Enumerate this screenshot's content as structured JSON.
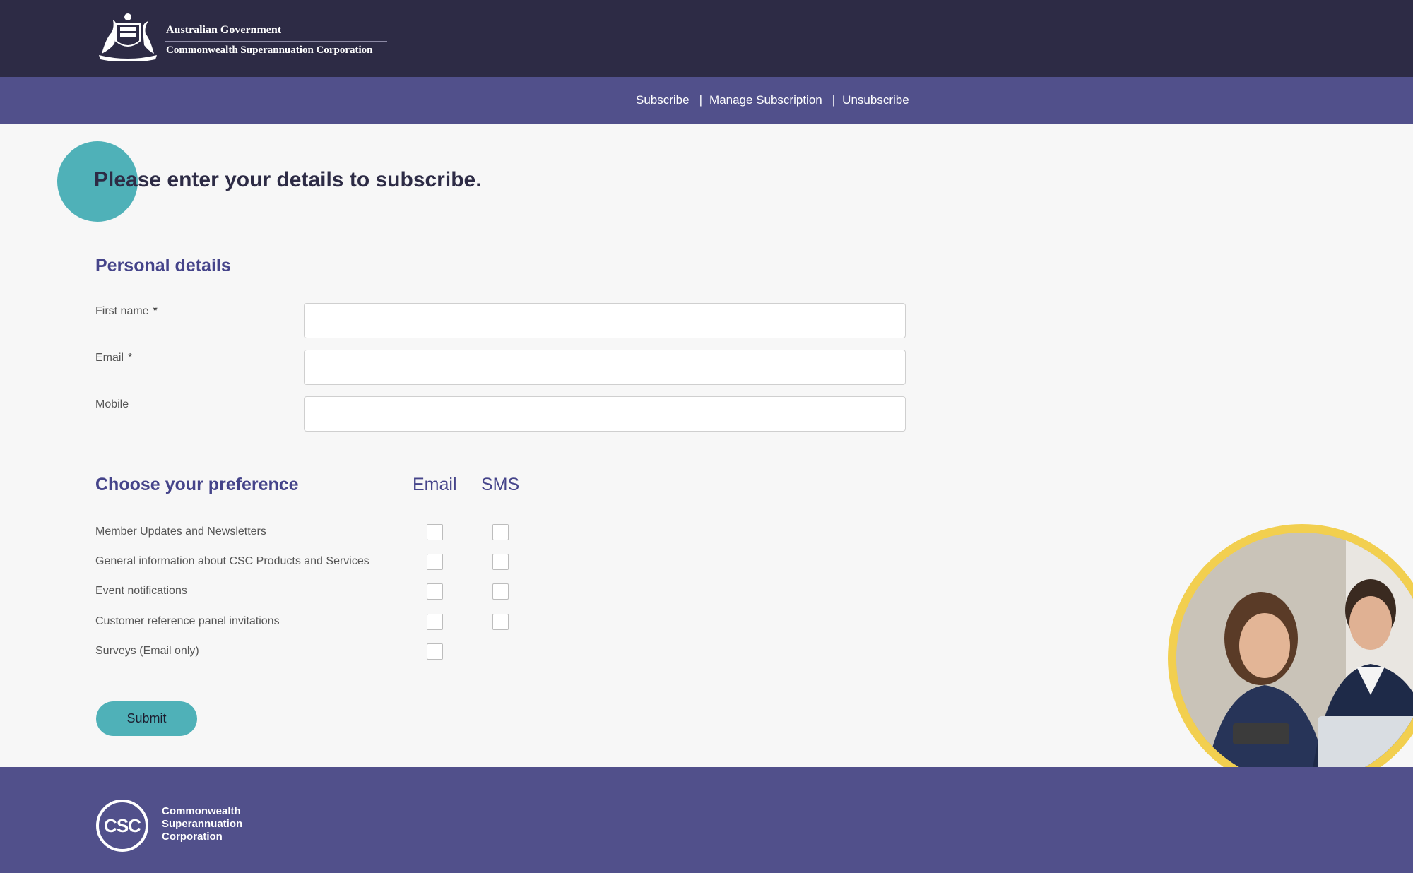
{
  "header": {
    "gov_line1": "Australian Government",
    "gov_line2": "Commonwealth Superannuation Corporation"
  },
  "nav": {
    "items": [
      "Subscribe",
      "Manage Subscription",
      "Unsubscribe"
    ],
    "separator": "|"
  },
  "page_title": "Please enter your details to subscribe.",
  "personal": {
    "heading": "Personal details",
    "required_marker": "*",
    "fields": [
      {
        "label": "First name",
        "value": ""
      },
      {
        "label": "Email",
        "value": ""
      },
      {
        "label": "Mobile",
        "value": ""
      }
    ]
  },
  "preference": {
    "heading": "Choose your preference",
    "col_email": "Email",
    "col_sms": "SMS",
    "rows": [
      {
        "label": "Member Updates and Newsletters",
        "email": false,
        "sms": false
      },
      {
        "label": "General information about CSC Products and Services",
        "email": false,
        "sms": false
      },
      {
        "label": "Event notifications",
        "email": false,
        "sms": false
      },
      {
        "label": "Customer reference panel invitations",
        "email": false,
        "sms": false
      },
      {
        "label": "Surveys (Email only)",
        "email": false
      }
    ]
  },
  "submit_label": "Submit",
  "footer": {
    "logo_mark": "CSC",
    "org_line1": "Commonwealth",
    "org_line2": "Superannuation",
    "org_line3": "Corporation"
  },
  "colors": {
    "header_bg": "#2d2b45",
    "nav_bg": "#51508b",
    "accent_teal": "#4fb1b8",
    "heading_purple": "#45448a",
    "photo_ring": "#f2cf4f"
  },
  "icons": [
    "coat-of-arms-icon",
    "csc-logo-icon"
  ]
}
